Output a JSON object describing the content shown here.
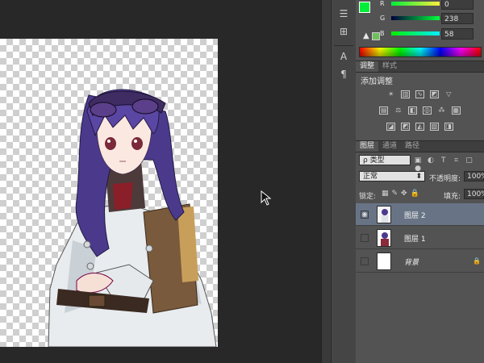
{
  "colors": {
    "foreground": "#00ee3a",
    "background": "#ffffff",
    "selected_layer": "#687486",
    "panel_bg": "#535353"
  },
  "color_panel": {
    "channels": [
      {
        "label": "R",
        "value": "0",
        "bar": "linear-gradient(90deg,#00ee3a,#ffee3a)"
      },
      {
        "label": "G",
        "value": "238",
        "bar": "linear-gradient(90deg,#00003a,#00ff3a)"
      },
      {
        "label": "B",
        "value": "58",
        "bar": "linear-gradient(90deg,#00ee00,#00eeff)"
      }
    ]
  },
  "adjustments": {
    "tabs": [
      "调整",
      "样式"
    ],
    "title": "添加调整",
    "rows": [
      [
        "sun-icon",
        "bars-icon",
        "curves-icon",
        "exposure-icon",
        "triangle-icon"
      ],
      [
        "hue-icon",
        "balance-icon",
        "bw-icon",
        "photo-filter-icon",
        "channel-mixer-icon",
        "lookup-icon"
      ],
      [
        "invert-icon",
        "posterize-icon",
        "threshold-icon",
        "gradient-map-icon",
        "selective-color-icon"
      ]
    ]
  },
  "layers_panel": {
    "tabs": [
      "图层",
      "通道",
      "路径"
    ],
    "filter_label": "ρ 类型",
    "blend_mode": "正常",
    "opacity_label": "不透明度:",
    "opacity_value": "100%",
    "lock_label": "锁定:",
    "fill_label": "填充:",
    "fill_value": "100%",
    "layers": [
      {
        "name": "图层 2",
        "visible": true,
        "selected": true
      },
      {
        "name": "图层 1",
        "visible": false,
        "selected": false
      },
      {
        "name": "背景",
        "visible": false,
        "selected": false,
        "locked": true
      }
    ]
  },
  "icon_strip": [
    "history-icon",
    "character-icon",
    "paragraph-icon"
  ]
}
